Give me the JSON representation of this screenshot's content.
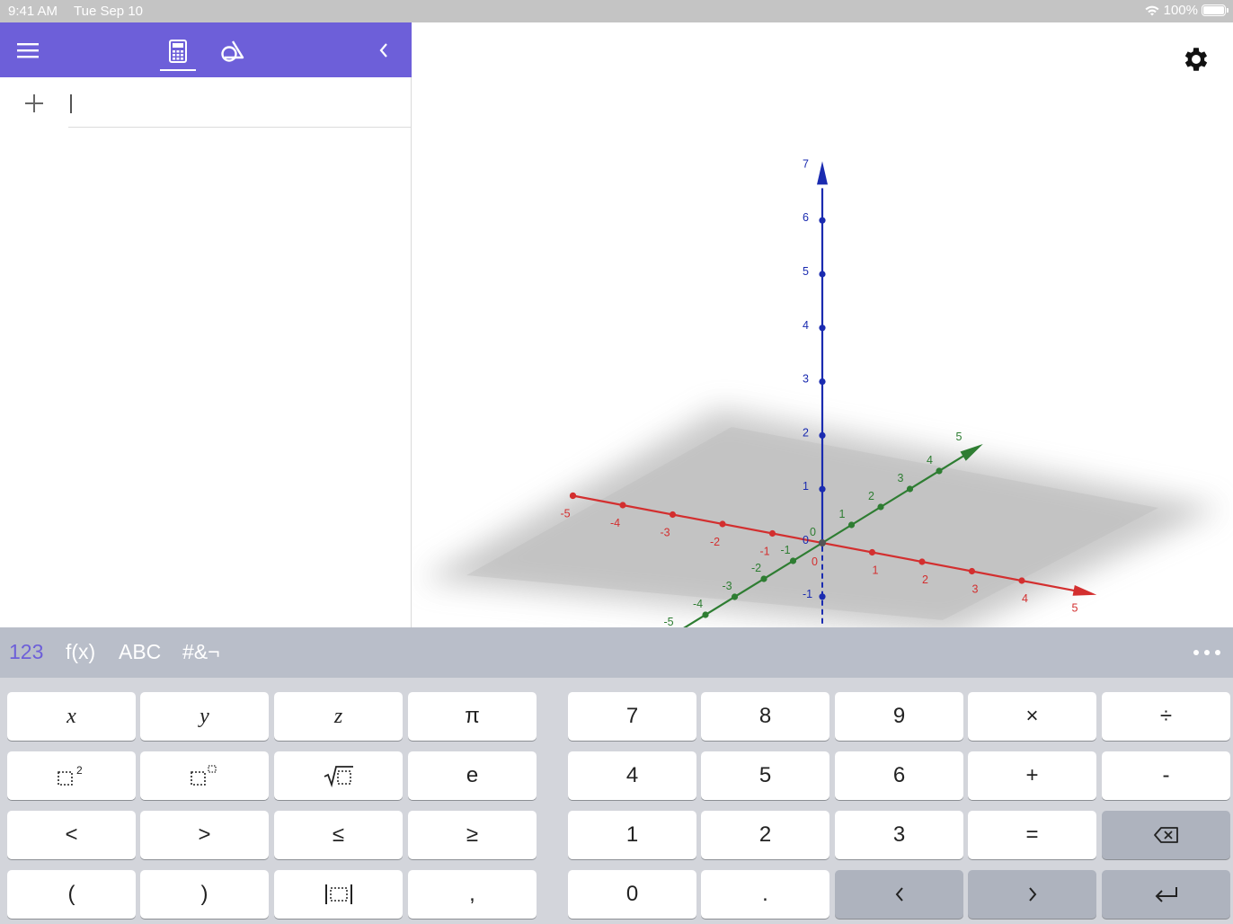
{
  "status_bar": {
    "time": "9:41 AM",
    "date": "Tue Sep 10",
    "battery": "100%"
  },
  "header": {
    "menu_icon": "hamburger-menu-icon",
    "tabs": [
      {
        "name": "calculator-tab",
        "icon": "calculator-icon",
        "active": true
      },
      {
        "name": "tools-tab",
        "icon": "geometry-tools-icon",
        "active": false
      }
    ],
    "collapse_icon": "chevron-left-icon",
    "accent": "#6d5fd9"
  },
  "algebra": {
    "input_value": "",
    "add_icon": "plus-icon"
  },
  "graphics": {
    "settings_icon": "gear-icon",
    "axes": {
      "x_labels": [
        "-5",
        "-4",
        "-3",
        "-2",
        "-1",
        "0",
        "1",
        "2",
        "3",
        "4",
        "5"
      ],
      "y_labels": [
        "-5",
        "-4",
        "-3",
        "-2",
        "-1",
        "0",
        "1",
        "2",
        "3",
        "4",
        "5"
      ],
      "z_labels": [
        "-1",
        "0",
        "1",
        "2",
        "3",
        "4",
        "5",
        "6",
        "7"
      ],
      "x_color": "#d32f2f",
      "y_color": "#2e7d32",
      "z_color": "#1a2bb0"
    }
  },
  "keyboard_tabs": {
    "tabs": [
      "123",
      "f(x)",
      "ABC",
      "#&¬"
    ],
    "active": "123"
  },
  "keyboard": {
    "left": [
      [
        "x",
        "y",
        "z",
        "π"
      ],
      [
        "square",
        "power",
        "sqrt",
        "e"
      ],
      [
        "<",
        ">",
        "≤",
        "≥"
      ],
      [
        "(",
        ")",
        "abs",
        ","
      ]
    ],
    "right": [
      [
        "7",
        "8",
        "9",
        "×",
        "÷"
      ],
      [
        "4",
        "5",
        "6",
        "+",
        "-"
      ],
      [
        "1",
        "2",
        "3",
        "=",
        "backspace"
      ],
      [
        "0",
        ".",
        "left",
        "right",
        "enter"
      ]
    ]
  }
}
